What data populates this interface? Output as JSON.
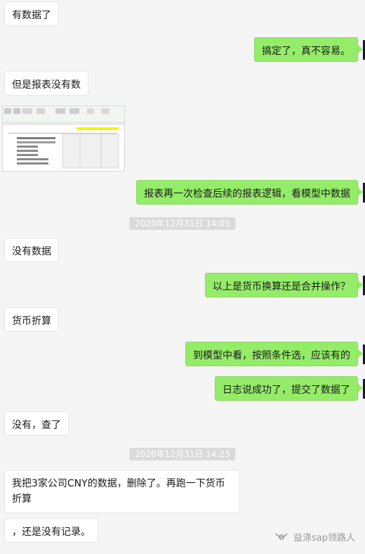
{
  "messages": [
    {
      "id": "m1",
      "side": "left",
      "text": "有数据了"
    },
    {
      "id": "m2",
      "side": "right",
      "text": "搞定了，真不容易。"
    },
    {
      "id": "m3",
      "side": "left",
      "text": "但是报表没有数"
    },
    {
      "id": "m4",
      "side": "left",
      "type": "image",
      "alt": "spreadsheet screenshot"
    },
    {
      "id": "m5",
      "side": "right",
      "text": "报表再一次检查后续的报表逻辑，看模型中数据"
    },
    {
      "id": "t1",
      "type": "time",
      "text": "2020年12月31日 14:05"
    },
    {
      "id": "m6",
      "side": "left",
      "text": "没有数据"
    },
    {
      "id": "m7",
      "side": "right",
      "text": "以上是货币换算还是合并操作？"
    },
    {
      "id": "m8",
      "side": "left",
      "text": "货币折算"
    },
    {
      "id": "m9",
      "side": "right",
      "text": "到模型中看，按照条件选，应该有的"
    },
    {
      "id": "m10",
      "side": "right",
      "text": "日志说成功了，提交了数据了"
    },
    {
      "id": "m11",
      "side": "left",
      "text": "没有，查了"
    },
    {
      "id": "t2",
      "type": "time",
      "text": "2020年12月31日 14:23"
    },
    {
      "id": "m12",
      "side": "left",
      "text": "我把3家公司CNY的数据，删除了。再跑一下货币折算"
    },
    {
      "id": "m13",
      "side": "left",
      "text": "，还是没有记录。"
    }
  ],
  "watermark": {
    "text": "益涤sap领路人",
    "icon": "wechat-channel-icon"
  },
  "colors": {
    "background": "#f5f5f5",
    "self_bubble": "#95ec69",
    "other_bubble": "#ffffff",
    "time_chip": "#dadada"
  }
}
